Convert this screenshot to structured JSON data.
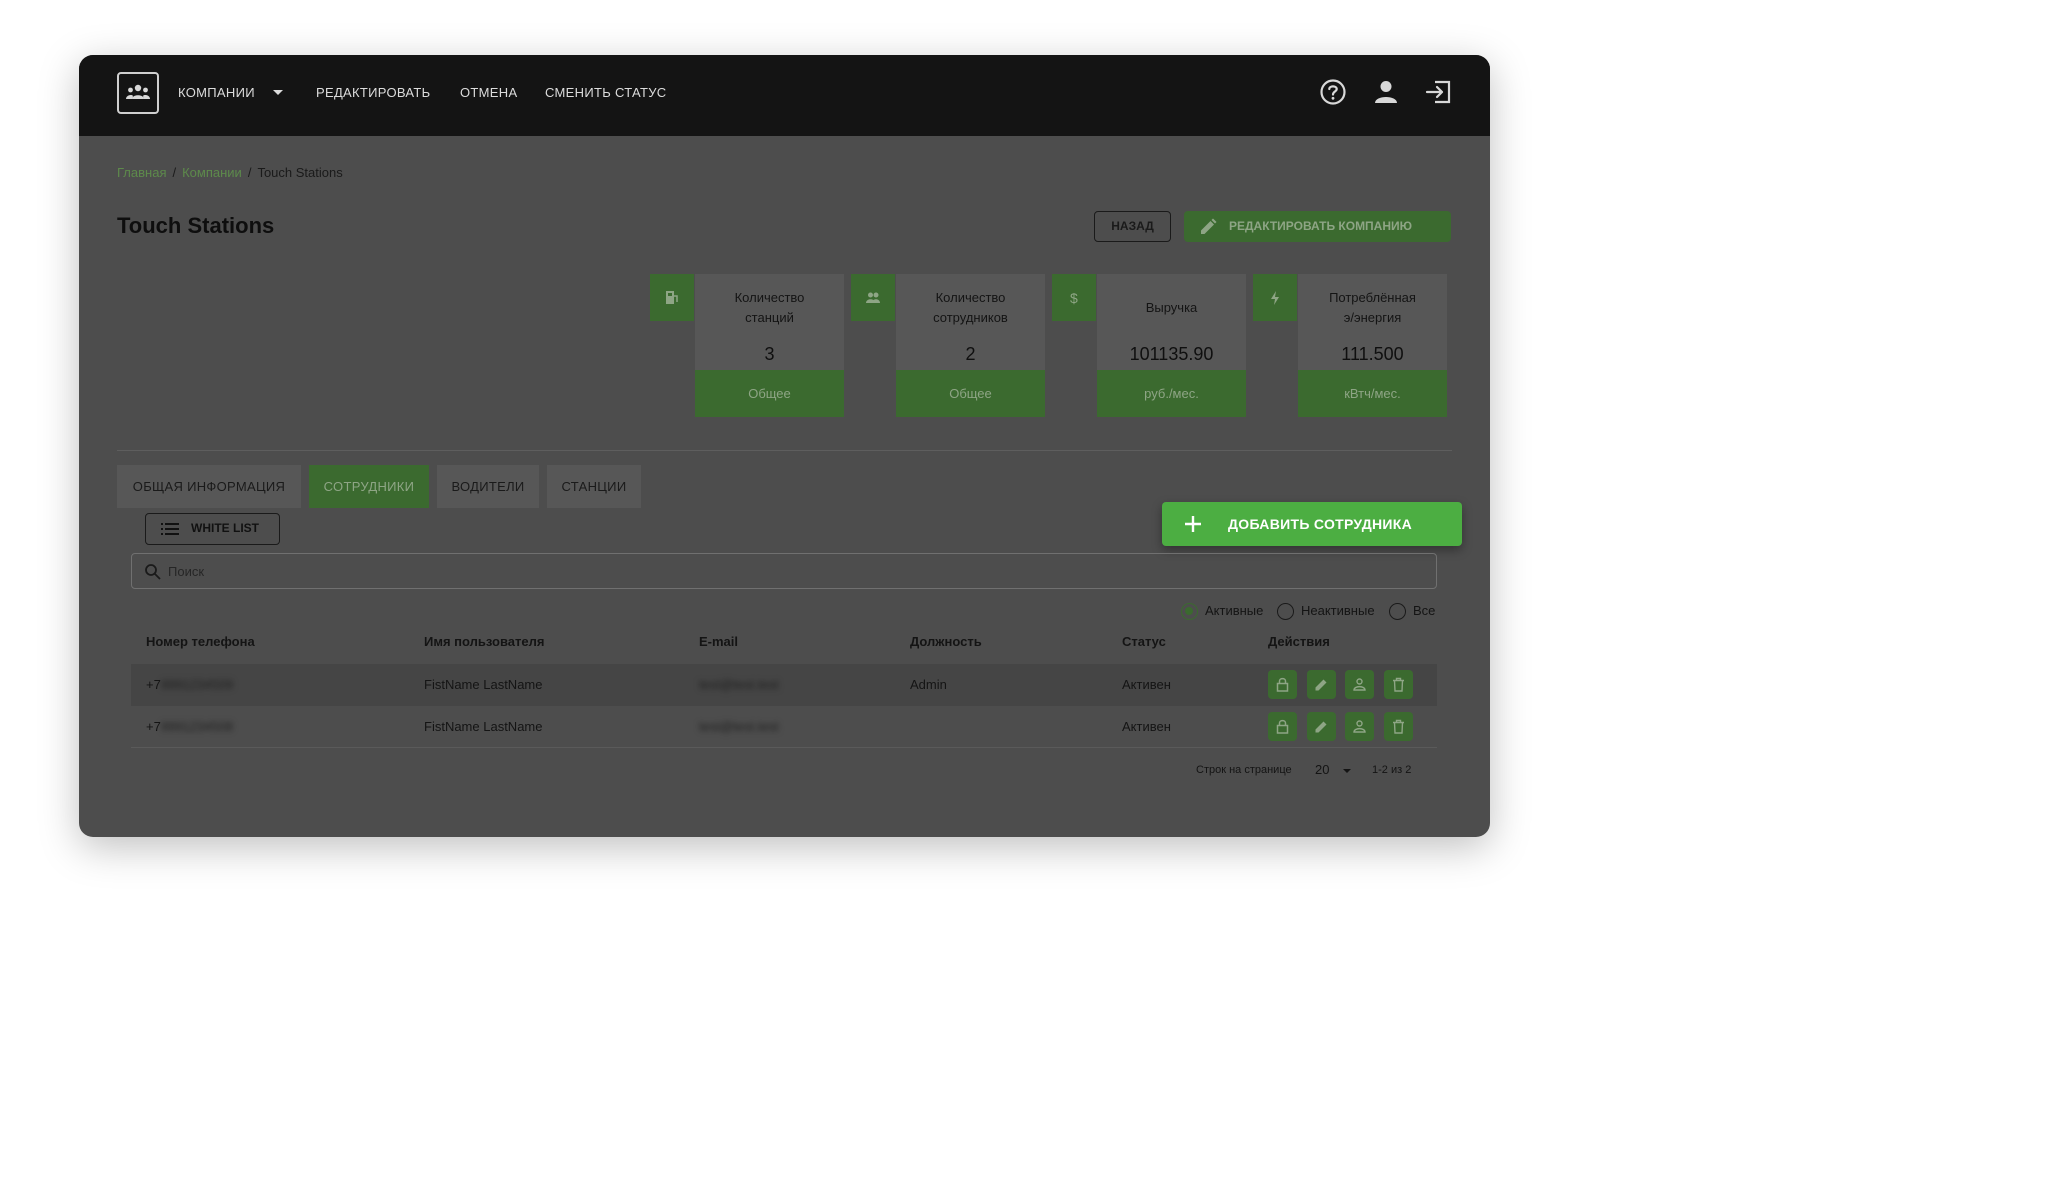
{
  "nav": {
    "companies": "КОМПАНИИ",
    "edit": "РЕДАКТИРОВАТЬ",
    "cancel": "ОТМЕНА",
    "change_status": "СМЕНИТЬ СТАТУС",
    "icons": [
      "help-icon",
      "user-icon",
      "logout-icon"
    ]
  },
  "breadcrumb": {
    "home": "Главная",
    "companies": "Компании",
    "current": "Touch Stations"
  },
  "page": {
    "title": "Touch Stations",
    "back_label": "НАЗАД",
    "edit_label": "РЕДАКТИРОВАТЬ КОМПАНИЮ"
  },
  "stats": [
    {
      "label1": "Количество",
      "label2": "станций",
      "value": "3",
      "foot": "Общее",
      "icon": "station-icon"
    },
    {
      "label1": "Количество",
      "label2": "сотрудников",
      "value": "2",
      "foot": "Общее",
      "icon": "people-icon"
    },
    {
      "label1": "Выручка",
      "label2": "",
      "value": "101135.90",
      "foot": "руб./мес.",
      "icon": "dollar-icon"
    },
    {
      "label1": "Потреблённая",
      "label2": "э/энергия",
      "value": "111.500",
      "foot": "кВтч/мес.",
      "icon": "bolt-icon"
    }
  ],
  "tabs": [
    {
      "label": "ОБЩАЯ ИНФОРМАЦИЯ",
      "active": false
    },
    {
      "label": "СОТРУДНИКИ",
      "active": true
    },
    {
      "label": "ВОДИТЕЛИ",
      "active": false
    },
    {
      "label": "СТАНЦИИ",
      "active": false
    }
  ],
  "whitelist_label": "WHITE LIST",
  "add_label": "ДОБАВИТЬ СОТРУДНИКА",
  "search": {
    "placeholder": "Поиск",
    "value": ""
  },
  "filters": {
    "active": "Активные",
    "inactive": "Неактивные",
    "all": "Все",
    "selected": "active"
  },
  "table": {
    "columns": [
      "Номер телефона",
      "Имя пользователя",
      "E-mail",
      "Должность",
      "Статус",
      "Действия"
    ],
    "rows": [
      {
        "phone_prefix": "+7",
        "phone_hidden": "9991234509",
        "name": "FistName LastName",
        "email": "test@test.test",
        "position": "Admin",
        "status": "Активен"
      },
      {
        "phone_prefix": "+7",
        "phone_hidden": "9991234508",
        "name": "FistName LastName",
        "email": "test@test.test",
        "position": "",
        "status": "Активен"
      }
    ],
    "actions": [
      "lock-icon",
      "edit-icon",
      "users-icon",
      "trash-icon"
    ]
  },
  "pager": {
    "rows_per_page_label": "Строк на странице",
    "rows_per_page": "20",
    "range": "1-2 из 2"
  },
  "colors": {
    "topbar": "#141414",
    "overlay": "#4d4d4d",
    "accent_dim": "#3b6a2f",
    "accent": "#4cae42",
    "link": "#5d8a4b"
  }
}
